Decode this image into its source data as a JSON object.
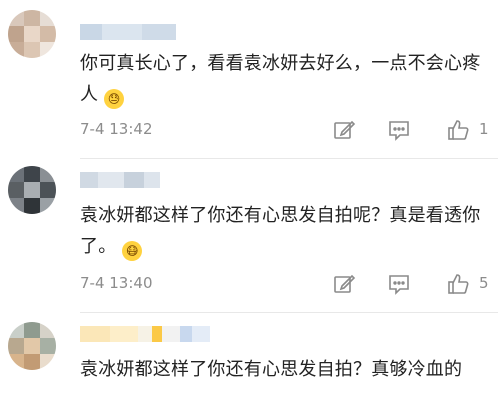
{
  "comments": [
    {
      "text": "你可真长心了，看看袁冰妍去好么，一点不会心疼人",
      "emoji": "😓",
      "date": "7-4 13:42",
      "like_count": "1"
    },
    {
      "text": "袁冰妍都这样了你还有心思发自拍呢？真是看透你了。",
      "emoji": "😷",
      "date": "7-4 13:40",
      "like_count": "5"
    },
    {
      "text": "袁冰妍都这样了你还有心思发自拍？真够冷血的",
      "emoji": "",
      "date": "",
      "like_count": ""
    }
  ],
  "icons": {
    "edit": "edit-icon",
    "comment": "comment-icon",
    "like": "thumbs-up-icon"
  }
}
